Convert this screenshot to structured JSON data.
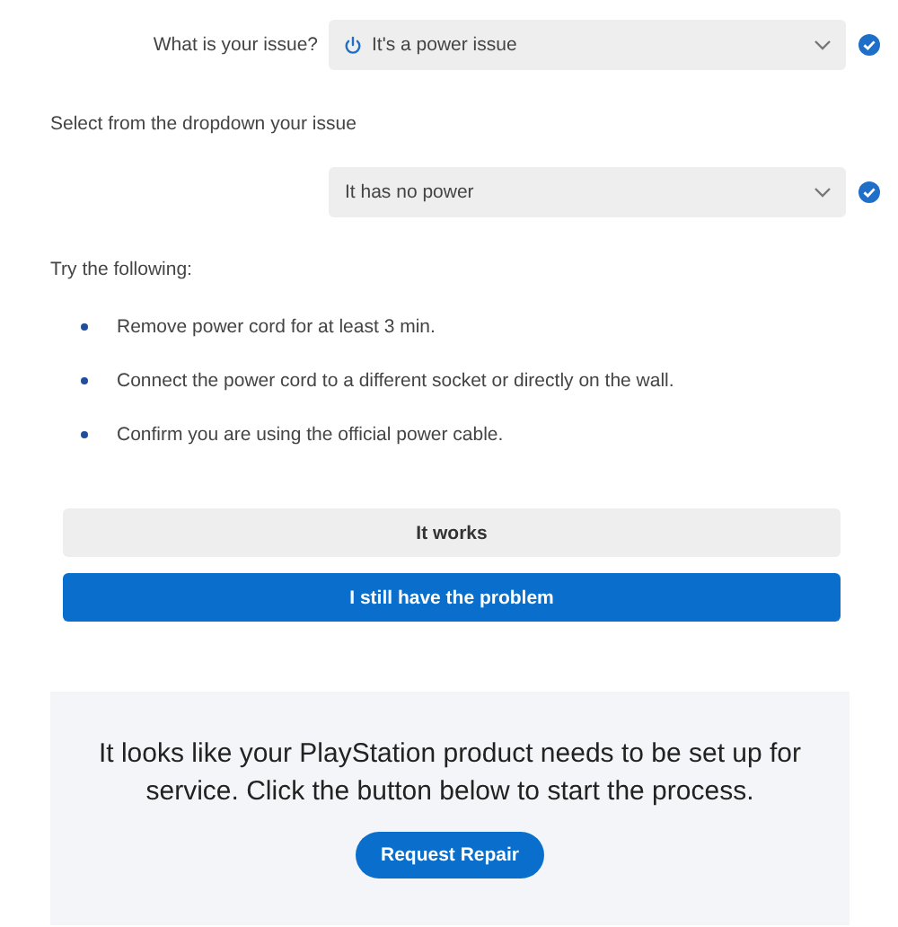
{
  "issue_select": {
    "label": "What is your issue?",
    "value": "It's a power issue",
    "kind": "with-icon",
    "confirmed": true
  },
  "sub_prompt": "Select from the dropdown your issue",
  "sub_select": {
    "value": "It has no power",
    "kind": "plain",
    "confirmed": true
  },
  "steps_heading": "Try the following:",
  "steps": [
    "Remove power cord for at least 3 min.",
    "Connect the power cord to a different socket or directly on the wall.",
    "Confirm you are using the official power cable."
  ],
  "buttons": [
    {
      "label": "It works",
      "kind": "secondary"
    },
    {
      "label": "I still have the problem",
      "kind": "primary"
    }
  ],
  "service_panel": {
    "message": "It looks like your PlayStation product needs to be set up for service. Click the button below to start the process.",
    "button": "Request Repair"
  }
}
